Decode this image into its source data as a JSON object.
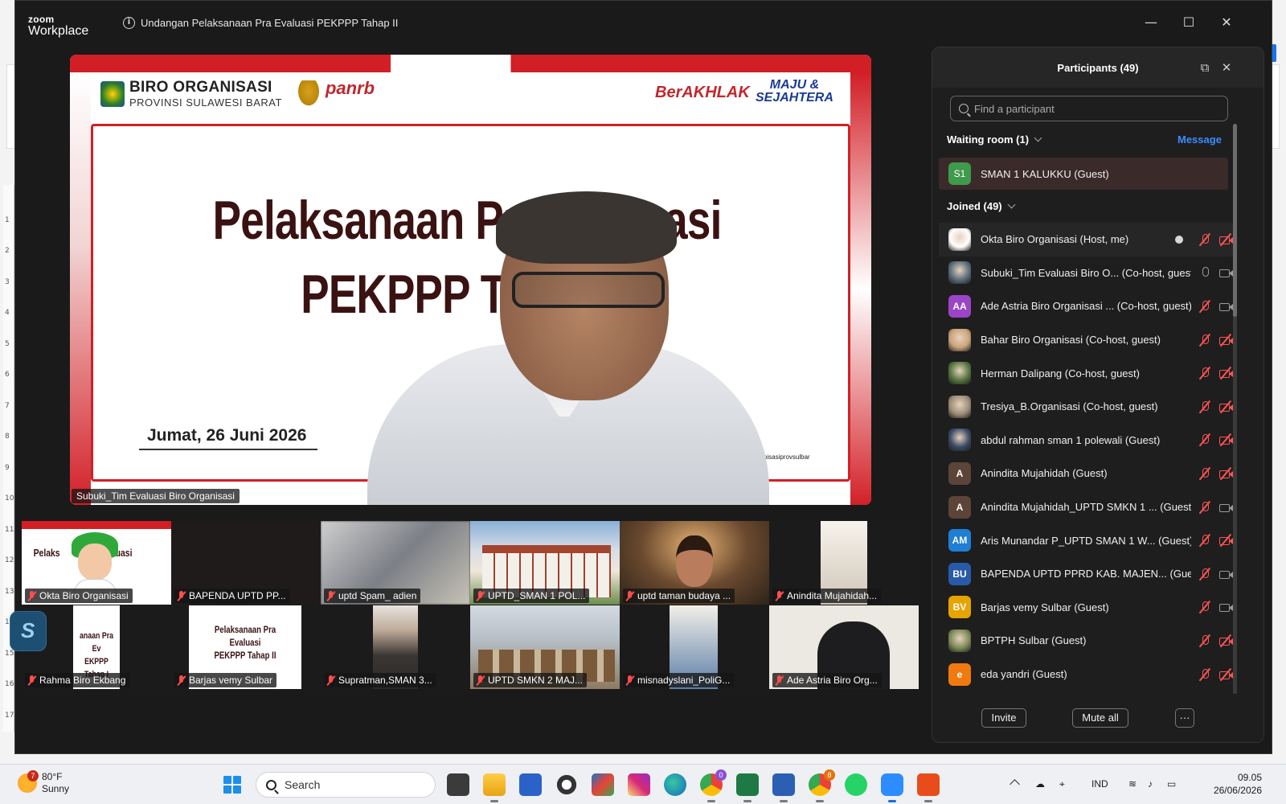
{
  "zoom": {
    "brand_top": "zoom",
    "brand_bottom": "Workplace",
    "meeting_title": "Undangan Pelaksanaan Pra Evaluasi PEKPPP Tahap II"
  },
  "stage": {
    "slide_org_line1": "BIRO ORGANISASI",
    "slide_org_line2": "PROVINSI SULAWESI BARAT",
    "slide_panrb": "panrb",
    "slide_berakhlak": "BerAKHLAK",
    "slide_maju_1": "MAJU &",
    "slide_maju_2": "SEJAHTERA",
    "slide_title_1": "Pelaksanaan Pra Evaluasi",
    "slide_title_2": "PEKPPP Tahap II",
    "slide_date": "Jumat, 26 Juni 2026",
    "slide_handle": "birorganisasiprovsulbar",
    "speaker_name": "Subuki_Tim Evaluasi Biro Organisasi"
  },
  "tiles": [
    {
      "label": "Okta Biro Organisasi"
    },
    {
      "label": "BAPENDA UPTD PP..."
    },
    {
      "label": "uptd Spam_ adien"
    },
    {
      "label": "UPTD_SMAN 1 POL..."
    },
    {
      "label": "uptd taman budaya ..."
    },
    {
      "label": "Anindita Mujahidah..."
    },
    {
      "label": "Rahma Biro Ekbang"
    },
    {
      "label": "Barjas vemy Sulbar"
    },
    {
      "label": "Supratman,SMAN 3..."
    },
    {
      "label": "UPTD SMKN 2 MAJ..."
    },
    {
      "label": "misnadyslani_PoliG..."
    },
    {
      "label": "Ade Astria Biro Org..."
    }
  ],
  "tile_slide_text": {
    "a": "Pelaks",
    "b": "Evaluasi",
    "c": "anaan Pra Ev",
    "d": "EKPPP Tahap I",
    "e": "Pelaksanaan Pra Evaluasi",
    "f": "PEKPPP Tahap II"
  },
  "panel": {
    "title": "Participants (49)",
    "search_placeholder": "Find a participant",
    "waiting_label": "Waiting room (1)",
    "message_label": "Message",
    "waiting_initials": "S1",
    "waiting_name": "SMAN 1 KALUKKU (Guest)",
    "joined_label": "Joined (49)",
    "invite_label": "Invite",
    "mute_all_label": "Mute all",
    "more_label": "···"
  },
  "participants": [
    {
      "name": "Okta Biro Organisasi (Host, me)",
      "avatar": "",
      "color": "#ffffff",
      "mic": "off",
      "cam": "off",
      "me": true
    },
    {
      "name": "Subuki_Tim Evaluasi Biro O... (Co-host, guest)",
      "avatar": "",
      "color": "#5b6c7a",
      "mic": "on",
      "cam": "on"
    },
    {
      "name": "Ade Astria Biro Organisasi ... (Co-host, guest)",
      "avatar": "AA",
      "color": "#9b45c6",
      "mic": "off",
      "cam": "on"
    },
    {
      "name": "Bahar Biro Organisasi (Co-host, guest)",
      "avatar": "",
      "color": "#caa47a",
      "mic": "off",
      "cam": "off"
    },
    {
      "name": "Herman Dalipang (Co-host, guest)",
      "avatar": "",
      "color": "#56753f",
      "mic": "off",
      "cam": "off"
    },
    {
      "name": "Tresiya_B.Organisasi (Co-host, guest)",
      "avatar": "",
      "color": "#9c8d7a",
      "mic": "off",
      "cam": "off"
    },
    {
      "name": "abdul rahman  sman 1 polewali (Guest)",
      "avatar": "",
      "color": "#3a4a66",
      "mic": "off",
      "cam": "off"
    },
    {
      "name": "Anindita Mujahidah (Guest)",
      "avatar": "A",
      "color": "#5c4438",
      "mic": "off",
      "cam": "off"
    },
    {
      "name": "Anindita Mujahidah_UPTD SMKN 1 ... (Guest)",
      "avatar": "A",
      "color": "#5c4438",
      "mic": "off",
      "cam": "on"
    },
    {
      "name": "Aris Munandar P_UPTD SMAN 1 W... (Guest)",
      "avatar": "AM",
      "color": "#1e7fd4",
      "mic": "off",
      "cam": "off"
    },
    {
      "name": "BAPENDA UPTD PPRD KAB. MAJEN... (Guest)",
      "avatar": "BU",
      "color": "#285aa8",
      "mic": "off",
      "cam": "on"
    },
    {
      "name": "Barjas vemy Sulbar (Guest)",
      "avatar": "BV",
      "color": "#e6a400",
      "mic": "off",
      "cam": "on"
    },
    {
      "name": "BPTPH Sulbar (Guest)",
      "avatar": "",
      "color": "#7d8a58",
      "mic": "off",
      "cam": "off"
    },
    {
      "name": "eda yandri (Guest)",
      "avatar": "e",
      "color": "#f07a10",
      "mic": "off",
      "cam": "off"
    }
  ],
  "taskbar": {
    "badge_weather": "7",
    "temp": "80°F",
    "condition": "Sunny",
    "search_label": "Search",
    "lang": "IND",
    "time": "09.05",
    "date": "26/06/2026",
    "chrome_badge": "0",
    "chrome2_badge": "8"
  }
}
